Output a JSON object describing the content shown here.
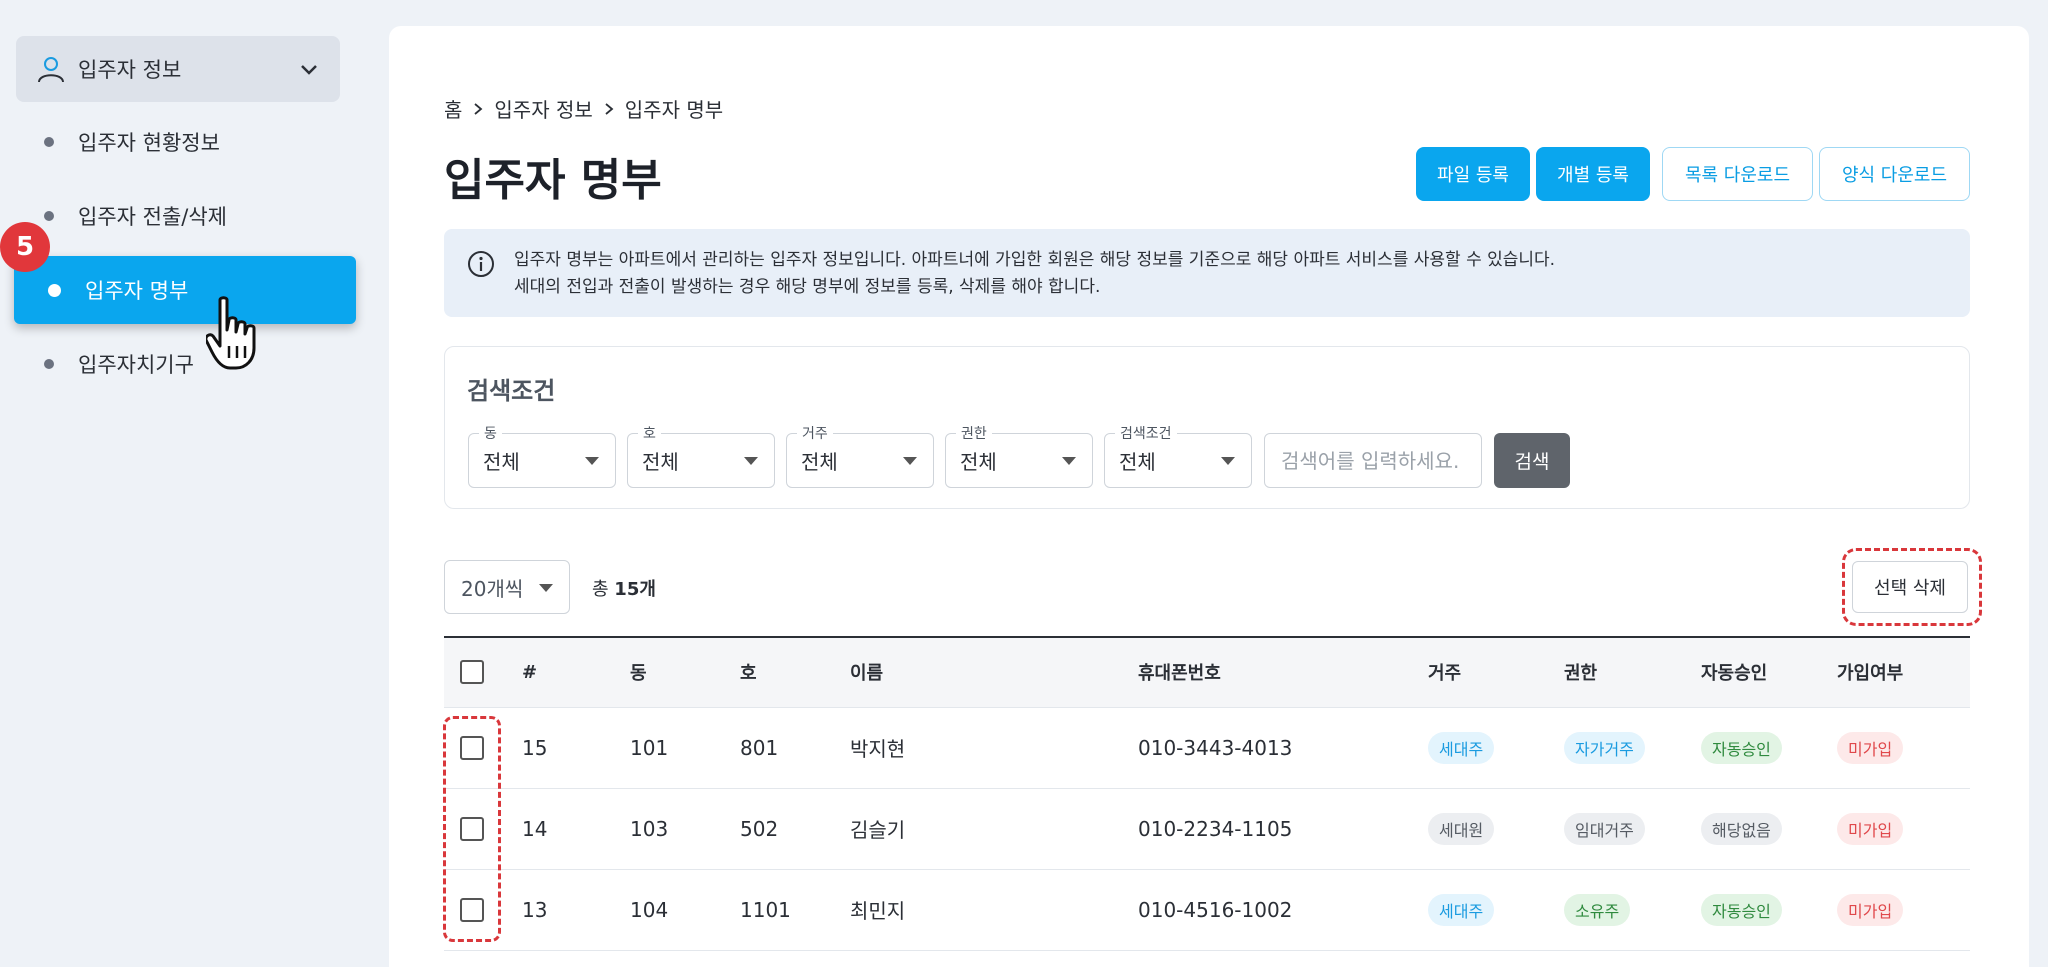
{
  "sidebar": {
    "group_label": "입주자 정보",
    "items": [
      {
        "label": "입주자 현황정보"
      },
      {
        "label": "입주자 전출/삭제"
      },
      {
        "label": "입주자 명부"
      },
      {
        "label": "입주자치기구"
      }
    ],
    "step_badge": "5"
  },
  "breadcrumb": [
    "홈",
    "입주자 정보",
    "입주자 명부"
  ],
  "page_title": "입주자 명부",
  "actions": {
    "file_register": "파일 등록",
    "individual_register": "개별 등록",
    "list_download": "목록 다운로드",
    "form_download": "양식 다운로드"
  },
  "notice": {
    "line1": "입주자 명부는 아파트에서 관리하는 입주자 정보입니다. 아파트너에 가입한 회원은 해당 정보를 기준으로 해당 아파트 서비스를 사용할 수 있습니다.",
    "line2": "세대의 전입과 전출이 발생하는 경우 해당 명부에 정보를 등록, 삭제를 해야 합니다."
  },
  "search": {
    "title": "검색조건",
    "filters": [
      {
        "label": "동",
        "value": "전체"
      },
      {
        "label": "호",
        "value": "전체"
      },
      {
        "label": "거주",
        "value": "전체"
      },
      {
        "label": "권한",
        "value": "전체"
      },
      {
        "label": "검색조건",
        "value": "전체"
      }
    ],
    "placeholder": "검색어를 입력하세요.",
    "button": "검색"
  },
  "list": {
    "per_page": "20개씩",
    "total_prefix": "총 ",
    "total_count": "15개",
    "delete_selected": "선택 삭제"
  },
  "table": {
    "headers": [
      "#",
      "동",
      "호",
      "이름",
      "휴대폰번호",
      "거주",
      "권한",
      "자동승인",
      "가입여부"
    ],
    "rows": [
      {
        "no": "15",
        "dong": "101",
        "ho": "801",
        "name": "박지현",
        "phone": "010-3443-4013",
        "residence": "세대주",
        "authority": "자가거주",
        "auto": "자동승인",
        "joined": "미가입"
      },
      {
        "no": "14",
        "dong": "103",
        "ho": "502",
        "name": "김슬기",
        "phone": "010-2234-1105",
        "residence": "세대원",
        "authority": "임대거주",
        "auto": "해당없음",
        "joined": "미가입"
      },
      {
        "no": "13",
        "dong": "104",
        "ho": "1101",
        "name": "최민지",
        "phone": "010-4516-1002",
        "residence": "세대주",
        "authority": "소유주",
        "auto": "자동승인",
        "joined": "미가입"
      }
    ]
  },
  "colors": {
    "accent": "#0aa6ee",
    "highlight": "#d9373b",
    "pill_blue_bg": "#e3f4fd",
    "pill_blue_fg": "#1a9be0",
    "pill_gray_bg": "#eceef1",
    "pill_gray_fg": "#555b63",
    "pill_green_bg": "#e2f4e4",
    "pill_green_fg": "#2f8a3e",
    "pill_red_bg": "#fde9e9",
    "pill_red_fg": "#e0484b"
  }
}
